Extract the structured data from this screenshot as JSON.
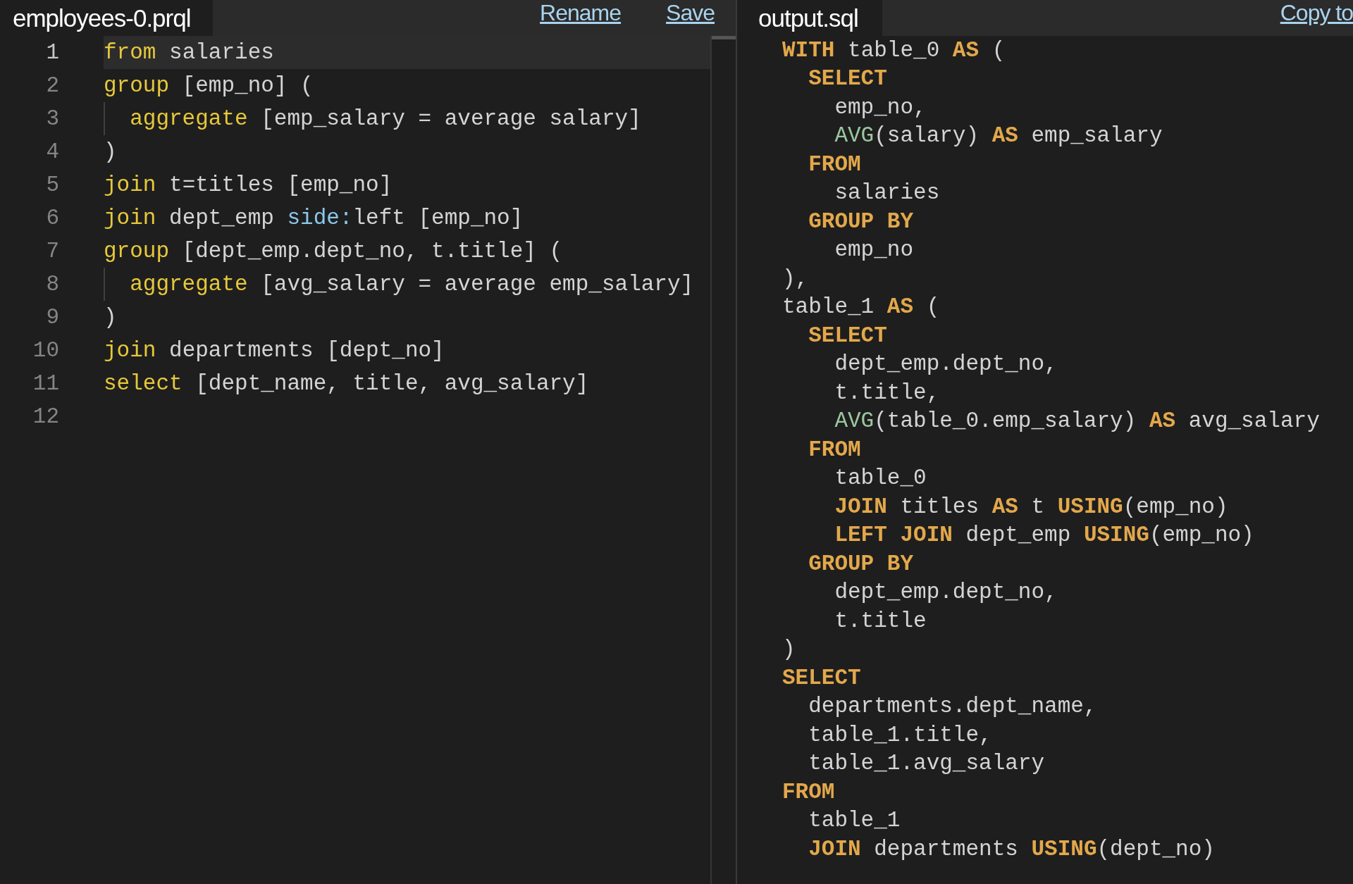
{
  "editors": [
    {
      "tab": {
        "label": "employees-0.prql"
      },
      "actions": [
        "Rename",
        "Save"
      ],
      "lines": [
        {
          "number": "1",
          "current": true,
          "tokens": [
            {
              "kind": "keyword",
              "text": "from"
            },
            {
              "kind": "text",
              "text": " salaries"
            }
          ]
        },
        {
          "number": "2",
          "current": false,
          "tokens": [
            {
              "kind": "keyword",
              "text": "group"
            },
            {
              "kind": "text",
              "text": " [emp_no] ("
            }
          ],
          "children": [
            {
              "number": "3",
              "current": false,
              "tokens": [
                {
                  "kind": "keyword",
                  "text": "aggregate"
                },
                {
                  "kind": "text",
                  "text": " [emp_salary = average salary]"
                }
              ]
            }
          ]
        },
        {
          "number": "4",
          "current": false,
          "tokens": [
            {
              "kind": "text",
              "text": ")"
            }
          ]
        },
        {
          "number": "5",
          "current": false,
          "tokens": [
            {
              "kind": "keyword",
              "text": "join"
            },
            {
              "kind": "text",
              "text": " t=titles [emp_no]"
            }
          ]
        },
        {
          "number": "6",
          "current": false,
          "tokens": [
            {
              "kind": "keyword",
              "text": "join"
            },
            {
              "kind": "text",
              "text": " dept_emp "
            },
            {
              "kind": "param",
              "text": "side:"
            },
            {
              "kind": "text",
              "text": "left [emp_no]"
            }
          ]
        },
        {
          "number": "7",
          "current": false,
          "tokens": [
            {
              "kind": "keyword",
              "text": "group"
            },
            {
              "kind": "text",
              "text": " [dept_emp.dept_no, t.title] ("
            }
          ],
          "children": [
            {
              "number": "8",
              "current": false,
              "tokens": [
                {
                  "kind": "keyword",
                  "text": "aggregate"
                },
                {
                  "kind": "text",
                  "text": " [avg_salary = average emp_salary]"
                }
              ]
            }
          ]
        },
        {
          "number": "9",
          "current": false,
          "tokens": [
            {
              "kind": "text",
              "text": ")"
            }
          ]
        },
        {
          "number": "10",
          "current": false,
          "tokens": [
            {
              "kind": "keyword",
              "text": "join"
            },
            {
              "kind": "text",
              "text": " departments [dept_no]"
            }
          ]
        },
        {
          "number": "11",
          "current": false,
          "tokens": [
            {
              "kind": "keyword",
              "text": "select"
            },
            {
              "kind": "text",
              "text": " [dept_name, title, avg_salary]"
            }
          ]
        },
        {
          "number": "12",
          "current": false
        }
      ]
    },
    {
      "tab": {
        "label": "output.sql"
      },
      "actions": [
        "Copy to"
      ],
      "lines": [
        {
          "tokens": [
            {
              "kind": "clause",
              "text": "WITH"
            },
            {
              "kind": "text",
              "text": " table_0 "
            },
            {
              "kind": "clause",
              "text": "AS"
            },
            {
              "kind": "text",
              "text": " ("
            }
          ],
          "children": [
            {
              "tokens": [
                {
                  "kind": "clause",
                  "text": "SELECT"
                }
              ],
              "children": [
                {
                  "tokens": [
                    {
                      "kind": "text",
                      "text": "emp_no,"
                    }
                  ]
                },
                {
                  "tokens": [
                    {
                      "kind": "function",
                      "text": "AVG"
                    },
                    {
                      "kind": "text",
                      "text": "(salary) "
                    },
                    {
                      "kind": "clause",
                      "text": "AS"
                    },
                    {
                      "kind": "text",
                      "text": " emp_salary"
                    }
                  ]
                }
              ]
            },
            {
              "tokens": [
                {
                  "kind": "clause",
                  "text": "FROM"
                }
              ],
              "children": [
                {
                  "tokens": [
                    {
                      "kind": "text",
                      "text": "salaries"
                    }
                  ]
                }
              ]
            },
            {
              "tokens": [
                {
                  "kind": "clause",
                  "text": "GROUP BY"
                }
              ],
              "children": [
                {
                  "tokens": [
                    {
                      "kind": "text",
                      "text": "emp_no"
                    }
                  ]
                }
              ]
            }
          ]
        },
        {
          "tokens": [
            {
              "kind": "text",
              "text": "),"
            }
          ]
        },
        {
          "tokens": [
            {
              "kind": "text",
              "text": "table_1 "
            },
            {
              "kind": "clause",
              "text": "AS"
            },
            {
              "kind": "text",
              "text": " ("
            }
          ],
          "children": [
            {
              "tokens": [
                {
                  "kind": "clause",
                  "text": "SELECT"
                }
              ],
              "children": [
                {
                  "tokens": [
                    {
                      "kind": "text",
                      "text": "dept_emp.dept_no,"
                    }
                  ]
                },
                {
                  "tokens": [
                    {
                      "kind": "text",
                      "text": "t.title,"
                    }
                  ]
                },
                {
                  "tokens": [
                    {
                      "kind": "function",
                      "text": "AVG"
                    },
                    {
                      "kind": "text",
                      "text": "(table_0.emp_salary) "
                    },
                    {
                      "kind": "clause",
                      "text": "AS"
                    },
                    {
                      "kind": "text",
                      "text": " avg_salary"
                    }
                  ]
                }
              ]
            },
            {
              "tokens": [
                {
                  "kind": "clause",
                  "text": "FROM"
                }
              ],
              "children": [
                {
                  "tokens": [
                    {
                      "kind": "text",
                      "text": "table_0"
                    }
                  ]
                },
                {
                  "tokens": [
                    {
                      "kind": "clause",
                      "text": "JOIN"
                    },
                    {
                      "kind": "text",
                      "text": " titles "
                    },
                    {
                      "kind": "clause",
                      "text": "AS"
                    },
                    {
                      "kind": "text",
                      "text": " t "
                    },
                    {
                      "kind": "clause",
                      "text": "USING"
                    },
                    {
                      "kind": "text",
                      "text": "(emp_no)"
                    }
                  ]
                },
                {
                  "tokens": [
                    {
                      "kind": "clause",
                      "text": "LEFT JOIN"
                    },
                    {
                      "kind": "text",
                      "text": " dept_emp "
                    },
                    {
                      "kind": "clause",
                      "text": "USING"
                    },
                    {
                      "kind": "text",
                      "text": "(emp_no)"
                    }
                  ]
                }
              ]
            },
            {
              "tokens": [
                {
                  "kind": "clause",
                  "text": "GROUP BY"
                }
              ],
              "children": [
                {
                  "tokens": [
                    {
                      "kind": "text",
                      "text": "dept_emp.dept_no,"
                    }
                  ]
                },
                {
                  "tokens": [
                    {
                      "kind": "text",
                      "text": "t.title"
                    }
                  ]
                }
              ]
            }
          ]
        },
        {
          "tokens": [
            {
              "kind": "text",
              "text": ")"
            }
          ]
        },
        {
          "tokens": [
            {
              "kind": "clause",
              "text": "SELECT"
            }
          ],
          "children": [
            {
              "tokens": [
                {
                  "kind": "text",
                  "text": "departments.dept_name,"
                }
              ]
            },
            {
              "tokens": [
                {
                  "kind": "text",
                  "text": "table_1.title,"
                }
              ]
            },
            {
              "tokens": [
                {
                  "kind": "text",
                  "text": "table_1.avg_salary"
                }
              ]
            }
          ]
        },
        {
          "tokens": [
            {
              "kind": "clause",
              "text": "FROM"
            }
          ],
          "children": [
            {
              "tokens": [
                {
                  "kind": "text",
                  "text": "table_1"
                }
              ]
            },
            {
              "tokens": [
                {
                  "kind": "clause",
                  "text": "JOIN"
                },
                {
                  "kind": "text",
                  "text": " departments "
                },
                {
                  "kind": "clause",
                  "text": "USING"
                },
                {
                  "kind": "text",
                  "text": "(dept_no)"
                }
              ]
            }
          ]
        }
      ]
    }
  ]
}
